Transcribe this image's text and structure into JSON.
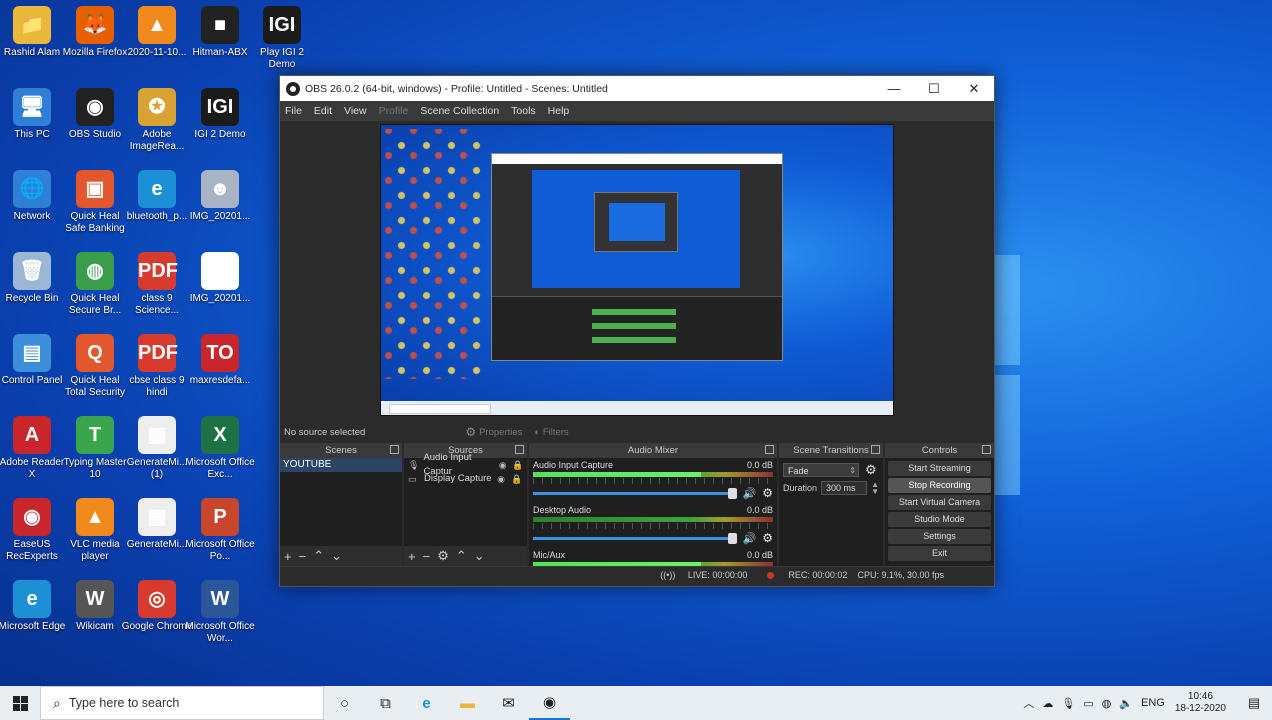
{
  "desktop_icons": [
    {
      "label": "Rashid Alam",
      "glyph": "📁",
      "color": "#e8b93a"
    },
    {
      "label": "Mozilla Firefox",
      "glyph": "🦊",
      "color": "#e66000"
    },
    {
      "label": "2020-11-10...",
      "glyph": "▲",
      "color": "#f08a1c"
    },
    {
      "label": "Hitman-ABX",
      "glyph": "■",
      "color": "#222222"
    },
    {
      "label": "Play IGI 2 Demo",
      "glyph": "IGI",
      "color": "#1b1b1b"
    },
    {
      "label": "This PC",
      "glyph": "🖥",
      "color": "#2f7fd6"
    },
    {
      "label": "OBS Studio",
      "glyph": "◉",
      "color": "#222222"
    },
    {
      "label": "Adobe ImageRea...",
      "glyph": "✪",
      "color": "#d9a234"
    },
    {
      "label": "IGI 2 Demo",
      "glyph": "IGI",
      "color": "#1b1b1b"
    },
    {
      "label": "Network",
      "glyph": "🌐",
      "color": "#2f7fd6"
    },
    {
      "label": "Quick Heal Safe Banking",
      "glyph": "▣",
      "color": "#e2572c"
    },
    {
      "label": "bluetooth_p...",
      "glyph": "e",
      "color": "#1d8fd4"
    },
    {
      "label": "IMG_20201...",
      "glyph": "☻",
      "color": "#a8b4c4"
    },
    {
      "label": "Recycle Bin",
      "glyph": "🗑",
      "color": "#9bb7d4"
    },
    {
      "label": "Quick Heal Secure Br...",
      "glyph": "◍",
      "color": "#3a9d4a"
    },
    {
      "label": "class 9 Science...",
      "glyph": "PDF",
      "color": "#d93a2e"
    },
    {
      "label": "IMG_20201...",
      "glyph": "✓",
      "color": "#ffffff"
    },
    {
      "label": "Control Panel",
      "glyph": "▤",
      "color": "#3d8fd9"
    },
    {
      "label": "Quick Heal Total Security",
      "glyph": "Q",
      "color": "#e2572c"
    },
    {
      "label": "cbse class 9 hindi",
      "glyph": "PDF",
      "color": "#d93a2e"
    },
    {
      "label": "maxresdefa...",
      "glyph": "TO",
      "color": "#c8262a"
    },
    {
      "label": "Adobe Reader X",
      "glyph": "A",
      "color": "#c8262a"
    },
    {
      "label": "Typing Master 10",
      "glyph": "T",
      "color": "#3aa54a"
    },
    {
      "label": "GenerateMi... (1)",
      "glyph": "▦",
      "color": "#eeeeee"
    },
    {
      "label": "Microsoft Office Exc...",
      "glyph": "X",
      "color": "#1e7145"
    },
    {
      "label": "EaseUS RecExperts",
      "glyph": "◉",
      "color": "#c8262a"
    },
    {
      "label": "VLC media player",
      "glyph": "▲",
      "color": "#f08a1c"
    },
    {
      "label": "GenerateMi...",
      "glyph": "▦",
      "color": "#eeeeee"
    },
    {
      "label": "Microsoft Office Po...",
      "glyph": "P",
      "color": "#c8462a"
    },
    {
      "label": "Microsoft Edge",
      "glyph": "e",
      "color": "#1d8fd4"
    },
    {
      "label": "Wikicam",
      "glyph": "W",
      "color": "#555555"
    },
    {
      "label": "Google Chrome",
      "glyph": "◎",
      "color": "#d93a2e"
    },
    {
      "label": "Microsoft Office Wor...",
      "glyph": "W",
      "color": "#2b579a"
    }
  ],
  "obs": {
    "title": "OBS 26.0.2 (64-bit, windows) - Profile: Untitled - Scenes: Untitled",
    "menu": [
      "File",
      "Edit",
      "View",
      "Profile",
      "Scene Collection",
      "Tools",
      "Help"
    ],
    "menu_disabled": [
      "Profile"
    ],
    "source_bar": {
      "status": "No source selected",
      "properties": "Properties",
      "filters": "Filters"
    },
    "docks": {
      "scenes": {
        "title": "Scenes",
        "items": [
          "YOUTUBE"
        ]
      },
      "sources": {
        "title": "Sources",
        "items": [
          {
            "label": "Audio Input Captur",
            "icon": "mic-icon"
          },
          {
            "label": "Display Capture",
            "icon": "monitor-icon"
          }
        ]
      },
      "mixer": {
        "title": "Audio Mixer",
        "channels": [
          {
            "name": "Audio Input Capture",
            "db": "0.0 dB"
          },
          {
            "name": "Desktop Audio",
            "db": "0.0 dB"
          },
          {
            "name": "Mic/Aux",
            "db": "0.0 dB"
          }
        ]
      },
      "transitions": {
        "title": "Scene Transitions",
        "selected": "Fade",
        "duration_label": "Duration",
        "duration_value": "300 ms"
      },
      "controls": {
        "title": "Controls",
        "buttons": [
          "Start Streaming",
          "Stop Recording",
          "Start Virtual Camera",
          "Studio Mode",
          "Settings",
          "Exit"
        ],
        "active": "Stop Recording"
      }
    },
    "status": {
      "live": "LIVE: 00:00:00",
      "rec": "REC: 00:00:02",
      "cpu": "CPU: 9.1%, 30.00 fps"
    }
  },
  "taskbar": {
    "search_placeholder": "Type here to search",
    "apps": [
      "cortana-icon",
      "task-view-icon",
      "edge-icon",
      "file-explorer-icon",
      "mail-icon",
      "obs-icon"
    ],
    "tray_lang": "ENG",
    "time": "10:46",
    "date": "18-12-2020"
  },
  "colors": {
    "accent": "#2c4566",
    "desktop": "#1060d8"
  }
}
